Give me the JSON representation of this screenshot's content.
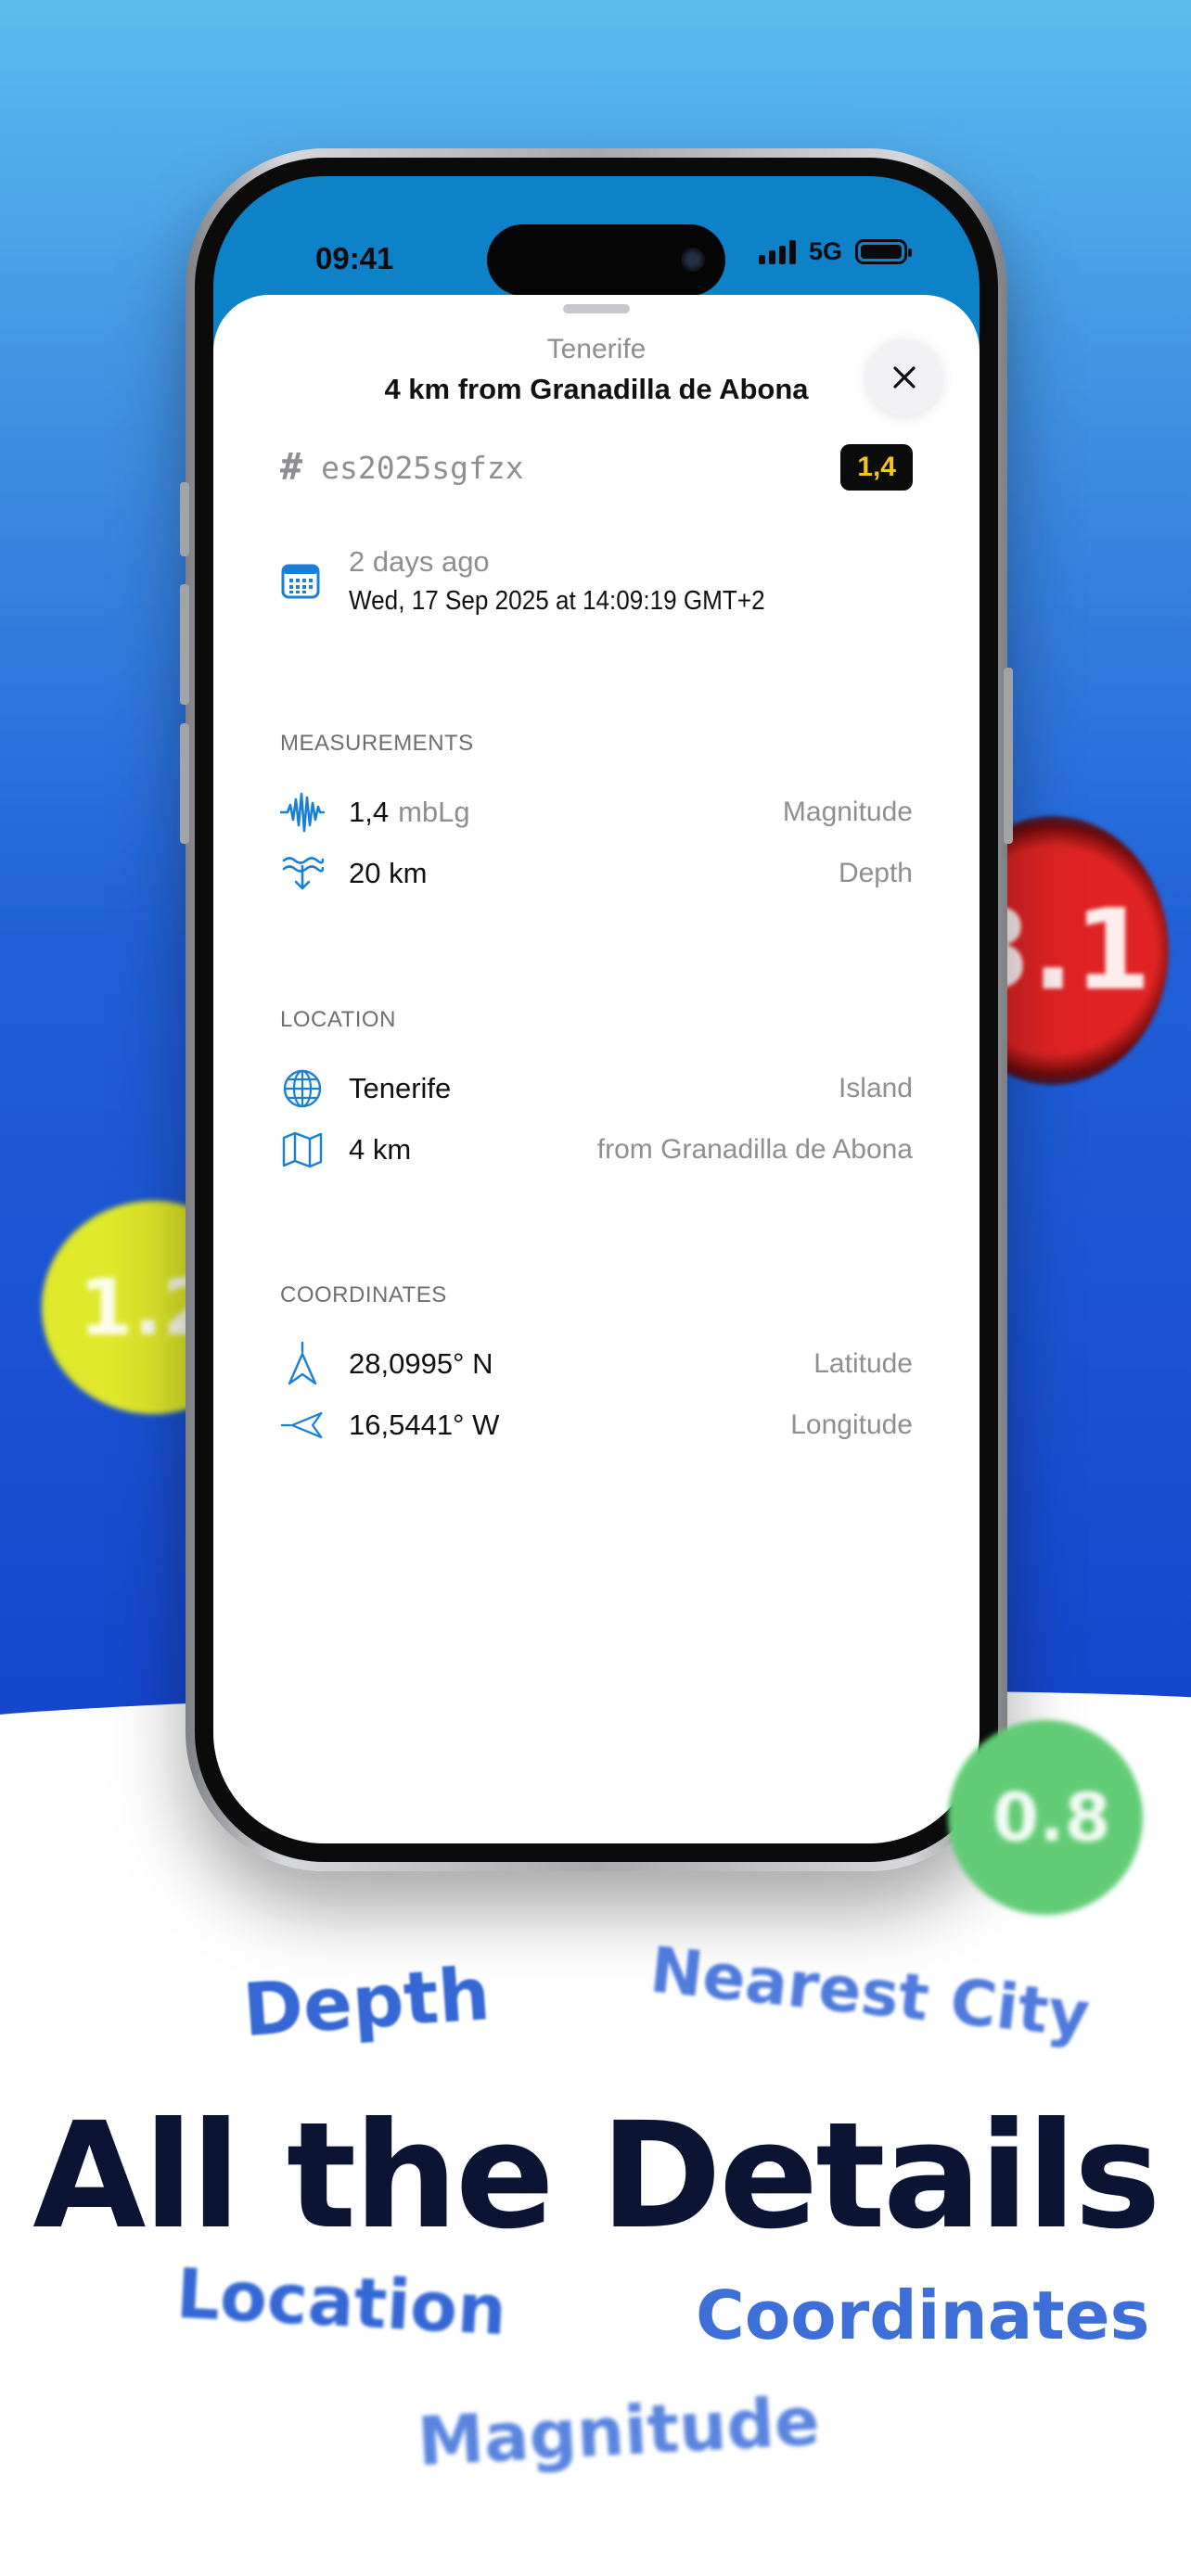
{
  "status_bar": {
    "time": "09:41",
    "network": "5G"
  },
  "sheet": {
    "subtitle": "Tenerife",
    "title": "4 km from Granadilla de Abona",
    "event_id_prefix": "#",
    "event_id": "es2025sgfzx",
    "magnitude_badge": "1,4",
    "date_relative": "2 days ago",
    "date_absolute": "Wed, 17 Sep 2025 at 14:09:19 GMT+2"
  },
  "measurements": {
    "header": "MEASUREMENTS",
    "magnitude": {
      "value": "1,4",
      "unit": "mbLg",
      "label": "Magnitude"
    },
    "depth": {
      "value": "20 km",
      "label": "Depth"
    }
  },
  "location": {
    "header": "LOCATION",
    "island": {
      "value": "Tenerife",
      "label": "Island"
    },
    "distance": {
      "value": "4 km",
      "label": "from Granadilla de Abona"
    }
  },
  "coordinates": {
    "header": "COORDINATES",
    "latitude": {
      "value": "28,0995° N",
      "label": "Latitude"
    },
    "longitude": {
      "value": "16,5441° W",
      "label": "Longitude"
    }
  },
  "bubbles": {
    "red": "3.1",
    "yellow": "1.2",
    "green": "0.8"
  },
  "marketing": {
    "headline": "All the Details",
    "words": {
      "depth": "Depth",
      "nearest_city": "Nearest City",
      "location": "Location",
      "coordinates": "Coordinates",
      "magnitude": "Magnitude"
    }
  },
  "colors": {
    "accent_blue": "#1a7fd6",
    "badge_yellow": "#f5c518",
    "headline_navy": "#0c1433",
    "word_blue": "#3568d4"
  }
}
